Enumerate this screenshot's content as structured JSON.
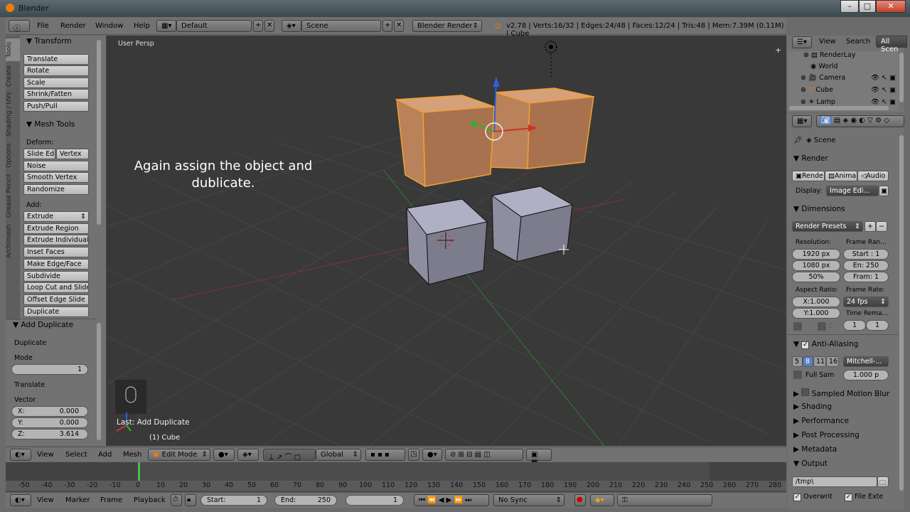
{
  "window": {
    "title": "Blender",
    "min": "–",
    "max": "□",
    "close": "✕"
  },
  "menubar": {
    "info_icon": "ⓘ",
    "menus": [
      "File",
      "Render",
      "Window",
      "Help"
    ],
    "layout": "Default",
    "scene": "Scene",
    "engine": "Blender Render",
    "stats": "v2.78 | Verts:16/32 | Edges:24/48 | Faces:12/24 | Tris:48 | Mem:7.39M (0.11M) | Cube"
  },
  "tool_tabs": [
    "Tools",
    "Create",
    "Shading / UVs",
    "Options",
    "Grease Pencil",
    "Archimesh"
  ],
  "left_panel": {
    "transform_title": "Transform",
    "transform_buttons": [
      "Translate",
      "Rotate",
      "Scale",
      "Shrink/Fatten",
      "Push/Pull"
    ],
    "mesh_tools_title": "Mesh Tools",
    "deform_label": "Deform:",
    "slide_edge": "Slide Ed",
    "vertex": "Vertex",
    "deform_buttons": [
      "Noise",
      "Smooth Vertex",
      "Randomize"
    ],
    "add_label": "Add:",
    "extrude": "Extrude",
    "add_buttons": [
      "Extrude Region",
      "Extrude Individual",
      "Inset Faces",
      "Make Edge/Face",
      "Subdivide",
      "Loop Cut and Slide",
      "Offset Edge Slide",
      "Duplicate"
    ],
    "operator_title": "Add Duplicate",
    "duplicate_label": "Duplicate",
    "mode_label": "Mode",
    "mode_value": "1",
    "translate_label": "Translate",
    "vector_label": "Vector",
    "x_label": "X:",
    "x_value": "0.000",
    "y_label": "Y:",
    "y_value": "0.000",
    "z_label": "Z:",
    "z_value": "3.614"
  },
  "viewport": {
    "view_name": "User Persp",
    "caption_line1": "Again assign the object and",
    "caption_line2": "dublicate.",
    "last_op": "Last: Add Duplicate",
    "object_info": "(1) Cube"
  },
  "view3d_header": {
    "menus": [
      "View",
      "Select",
      "Add",
      "Mesh"
    ],
    "mode": "Edit Mode",
    "orientation": "Global"
  },
  "timeline": {
    "ticks": [
      "-50",
      "-40",
      "-30",
      "-20",
      "-10",
      "0",
      "10",
      "20",
      "30",
      "40",
      "50",
      "60",
      "70",
      "80",
      "90",
      "100",
      "110",
      "120",
      "130",
      "140",
      "150",
      "160",
      "170",
      "180",
      "190",
      "200",
      "210",
      "220",
      "230",
      "240",
      "250",
      "260",
      "270",
      "280"
    ],
    "menus": [
      "View",
      "Marker",
      "Frame",
      "Playback"
    ],
    "start_label": "Start:",
    "start_value": "1",
    "end_label": "End:",
    "end_value": "250",
    "current_frame": "1",
    "sync": "No Sync"
  },
  "outliner": {
    "menus": [
      "View",
      "Search"
    ],
    "filter": "All Scen",
    "items": [
      "RenderLay",
      "World",
      "Camera",
      "Cube",
      "Lamp"
    ]
  },
  "properties": {
    "breadcrumb": "Scene",
    "render_title": "Render",
    "render_buttons": [
      "Rende",
      "Anima",
      "Audio"
    ],
    "display_label": "Display:",
    "display_value": "Image Edi...",
    "dimensions_title": "Dimensions",
    "render_presets": "Render Presets",
    "resolution_label": "Resolution:",
    "res_x": "1920 px",
    "res_y": "1080 px",
    "res_pct": "50%",
    "frame_range_label": "Frame Ran...",
    "frame_start": "Start : 1",
    "frame_end": "En: 250",
    "frame_step": "Fram: 1",
    "aspect_label": "Aspect Ratio:",
    "aspect_x": "X:1.000",
    "aspect_y": "Y:1.000",
    "frame_rate_label": "Frame Rate:",
    "fps": "24 fps",
    "time_remap_label": "Time Rema...",
    "time_old": "1",
    "time_new": "1",
    "crop_letter": "C",
    "aa_title": "Anti-Aliasing",
    "aa_samples": [
      "5",
      "8",
      "11",
      "16"
    ],
    "aa_filter": "Mitchell-...",
    "full_sample": "Full Sam",
    "filter_size": "1.000 p",
    "motion_blur": "Sampled Motion Blur",
    "shading": "Shading",
    "performance": "Performance",
    "post_processing": "Post Processing",
    "metadata": "Metadata",
    "output": "Output",
    "output_path": "/tmp\\",
    "overwrite": "Overwrit",
    "file_ext": "File Exte"
  },
  "colors": {
    "selected_cube": "#c88a5c",
    "cube": "#9a9aa8",
    "grid_x": "#8a3030",
    "grid_y": "#2f7a2f"
  }
}
